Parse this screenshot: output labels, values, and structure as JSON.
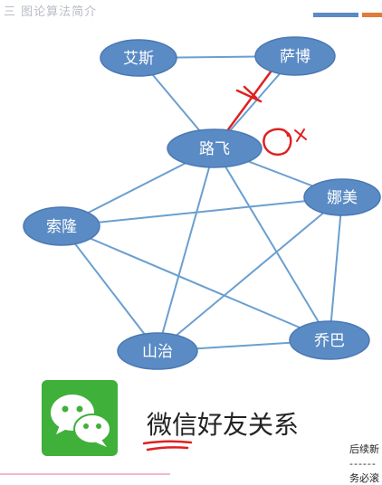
{
  "header": {
    "title": "三 图论算法简介"
  },
  "graph": {
    "nodes": [
      {
        "id": "aisi",
        "label": "艾斯"
      },
      {
        "id": "sabo",
        "label": "萨博"
      },
      {
        "id": "lufei",
        "label": "路飞"
      },
      {
        "id": "namei",
        "label": "娜美"
      },
      {
        "id": "suolong",
        "label": "索隆"
      },
      {
        "id": "shanzhi",
        "label": "山治"
      },
      {
        "id": "qiaoba",
        "label": "乔巴"
      }
    ],
    "edges": [
      [
        "aisi",
        "sabo"
      ],
      [
        "aisi",
        "lufei"
      ],
      [
        "sabo",
        "lufei"
      ],
      [
        "lufei",
        "namei"
      ],
      [
        "lufei",
        "suolong"
      ],
      [
        "lufei",
        "shanzhi"
      ],
      [
        "lufei",
        "qiaoba"
      ],
      [
        "suolong",
        "namei"
      ],
      [
        "suolong",
        "shanzhi"
      ],
      [
        "suolong",
        "qiaoba"
      ],
      [
        "namei",
        "shanzhi"
      ],
      [
        "namei",
        "qiaoba"
      ],
      [
        "shanzhi",
        "qiaoba"
      ]
    ],
    "node_color": "#5b8bc4",
    "edge_color": "#6a9fd0",
    "annotation_color": "#e02020"
  },
  "caption": "微信好友关系",
  "side_notes": {
    "line1": "后续新",
    "dashes": "------",
    "line2": "务必滚"
  }
}
